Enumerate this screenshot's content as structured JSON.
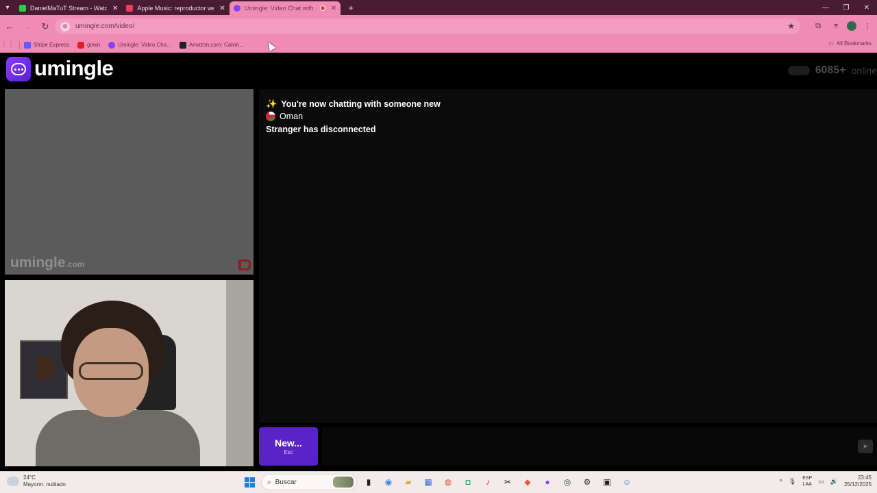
{
  "browser": {
    "tabs": [
      {
        "title": "DanielMaTuT Stream - Watch l",
        "favicon_color": "#2ecc40",
        "active": false
      },
      {
        "title": "Apple Music: reproductor web",
        "favicon_color": "#f23b5a",
        "active": false
      },
      {
        "title": "Umingle: Video Chat with S",
        "favicon_color": "#8a3cff",
        "active": true
      }
    ],
    "url": "umingle.com/video/",
    "bookmarks": [
      {
        "label": "Stripe Express",
        "color": "#635bff"
      },
      {
        "label": "gown",
        "color": "#e02020"
      },
      {
        "label": "Umingle: Video Cha...",
        "color": "#8a3cff"
      },
      {
        "label": "Amazon.com: Calvin...",
        "color": "#222222"
      }
    ],
    "all_bookmarks_label": "All Bookmarks"
  },
  "site": {
    "logo_text": "umingle",
    "online_count": "6085",
    "online_suffix": "+",
    "online_label": "online",
    "watermark": "umingle",
    "watermark_tld": ".com"
  },
  "chat": {
    "messages": [
      {
        "icon": "sparkles-icon",
        "text": "You're now chatting with someone new"
      },
      {
        "icon": "oman-flag-icon",
        "text": "Oman"
      },
      {
        "icon": "",
        "text": "Stranger has disconnected"
      }
    ],
    "new_button_label": "New...",
    "new_button_hint": "Esc",
    "input_value": ""
  },
  "taskbar": {
    "temperature": "24°C",
    "weather_desc": "Mayorm. nublado",
    "search_placeholder": "Buscar",
    "lang_line1": "ESP",
    "lang_line2": "LAA",
    "time": "23:45",
    "date": "25/12/2025"
  },
  "colors": {
    "accent": "#5a23c8",
    "browser_theme": "#f08cb4"
  }
}
